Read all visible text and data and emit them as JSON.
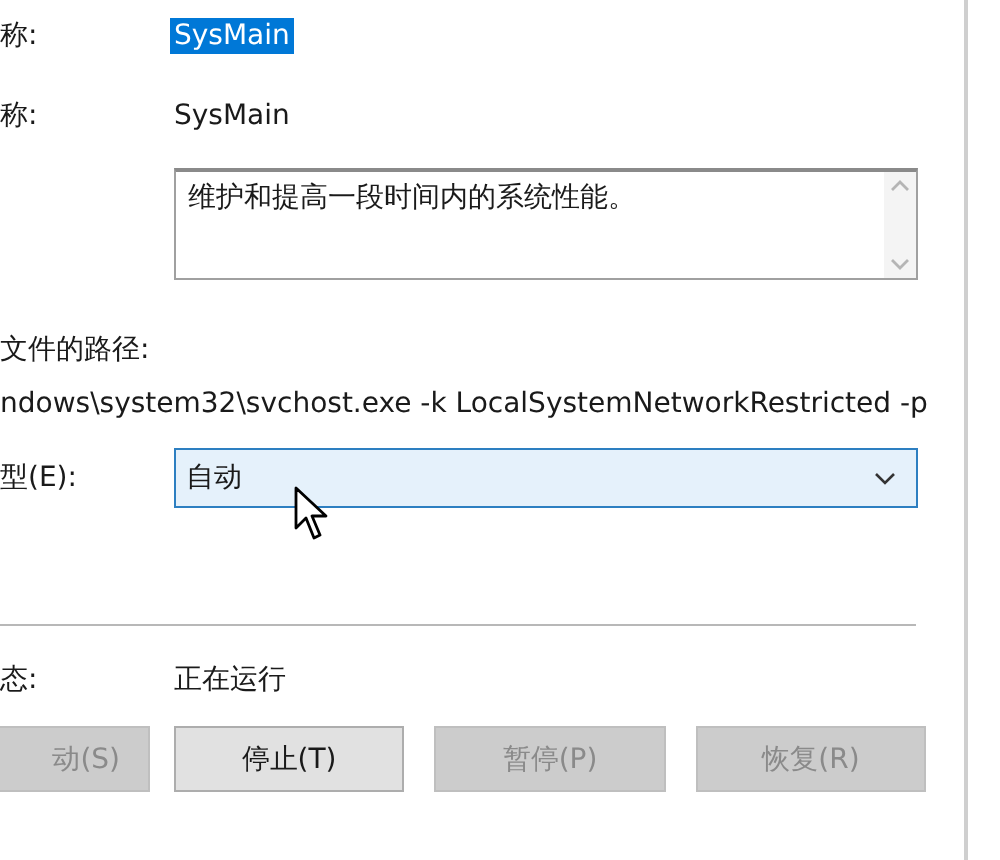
{
  "service_name": {
    "label": "称:",
    "value": "SysMain",
    "selected": true
  },
  "display_name": {
    "label": "称:",
    "value": "SysMain"
  },
  "description": {
    "value": "维护和提高一段时间内的系统性能。"
  },
  "executable_path": {
    "label": "文件的路径:",
    "value": "ndows\\system32\\svchost.exe -k LocalSystemNetworkRestricted -p"
  },
  "startup_type": {
    "label": "型(E):",
    "value": "自动"
  },
  "service_status": {
    "label": "态:",
    "value": "正在运行"
  },
  "buttons": [
    {
      "label": "动(S)",
      "disabled": true
    },
    {
      "label": "停止(T)",
      "disabled": false
    },
    {
      "label": "暂停(P)",
      "disabled": true
    },
    {
      "label": "恢复(R)",
      "disabled": true
    }
  ]
}
